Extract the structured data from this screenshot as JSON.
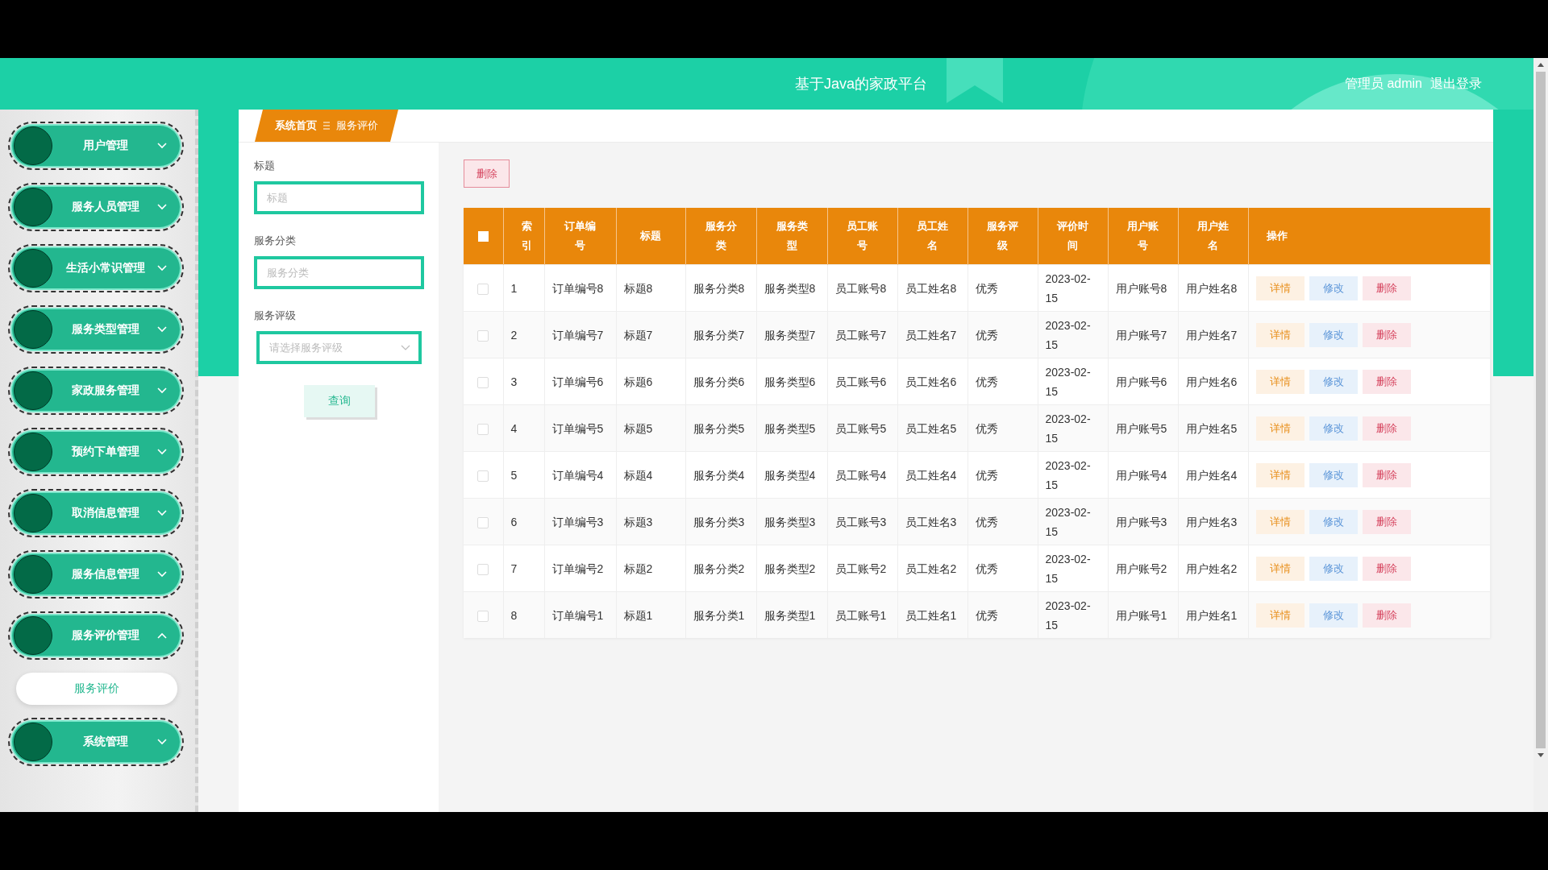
{
  "header": {
    "title": "基于Java的家政平台",
    "user": "管理员 admin",
    "logout": "退出登录"
  },
  "sidebar": {
    "items": [
      {
        "label": "用户管理",
        "expanded": false
      },
      {
        "label": "服务人员管理",
        "expanded": false
      },
      {
        "label": "生活小常识管理",
        "expanded": false
      },
      {
        "label": "服务类型管理",
        "expanded": false
      },
      {
        "label": "家政服务管理",
        "expanded": false
      },
      {
        "label": "预约下单管理",
        "expanded": false
      },
      {
        "label": "取消信息管理",
        "expanded": false
      },
      {
        "label": "服务信息管理",
        "expanded": false
      },
      {
        "label": "服务评价管理",
        "expanded": true,
        "children": [
          {
            "label": "服务评价",
            "selected": true
          }
        ]
      },
      {
        "label": "系统管理",
        "expanded": false
      }
    ]
  },
  "breadcrumb": {
    "home": "系统首页",
    "current": "服务评价"
  },
  "search": {
    "fields": [
      {
        "kind": "input",
        "label": "标题",
        "placeholder": "标题"
      },
      {
        "kind": "input",
        "label": "服务分类",
        "placeholder": "服务分类"
      },
      {
        "kind": "select",
        "label": "服务评级",
        "placeholder": "请选择服务评级"
      }
    ],
    "button": "查询"
  },
  "toolbar": {
    "delete": "删除"
  },
  "table": {
    "columns": [
      "索引",
      "订单编号",
      "标题",
      "服务分类",
      "服务类型",
      "员工账号",
      "员工姓名",
      "服务评级",
      "评价时间",
      "用户账号",
      "用户姓名",
      "操作"
    ],
    "select_all_checked": false,
    "rows": [
      {
        "checked": false,
        "cells": [
          "1",
          "订单编号8",
          "标题8",
          "服务分类8",
          "服务类型8",
          "员工账号8",
          "员工姓名8",
          "优秀",
          "2023-02-15",
          "用户账号8",
          "用户姓名8"
        ],
        "actions": [
          {
            "kind": "detail",
            "label": "详情"
          },
          {
            "kind": "edit",
            "label": "修改"
          },
          {
            "kind": "delete",
            "label": "删除"
          }
        ]
      },
      {
        "checked": false,
        "cells": [
          "2",
          "订单编号7",
          "标题7",
          "服务分类7",
          "服务类型7",
          "员工账号7",
          "员工姓名7",
          "优秀",
          "2023-02-15",
          "用户账号7",
          "用户姓名7"
        ],
        "actions": [
          {
            "kind": "detail",
            "label": "详情"
          },
          {
            "kind": "edit",
            "label": "修改"
          },
          {
            "kind": "delete",
            "label": "删除"
          }
        ]
      },
      {
        "checked": false,
        "cells": [
          "3",
          "订单编号6",
          "标题6",
          "服务分类6",
          "服务类型6",
          "员工账号6",
          "员工姓名6",
          "优秀",
          "2023-02-15",
          "用户账号6",
          "用户姓名6"
        ],
        "actions": [
          {
            "kind": "detail",
            "label": "详情"
          },
          {
            "kind": "edit",
            "label": "修改"
          },
          {
            "kind": "delete",
            "label": "删除"
          }
        ]
      },
      {
        "checked": false,
        "cells": [
          "4",
          "订单编号5",
          "标题5",
          "服务分类5",
          "服务类型5",
          "员工账号5",
          "员工姓名5",
          "优秀",
          "2023-02-15",
          "用户账号5",
          "用户姓名5"
        ],
        "actions": [
          {
            "kind": "detail",
            "label": "详情"
          },
          {
            "kind": "edit",
            "label": "修改"
          },
          {
            "kind": "delete",
            "label": "删除"
          }
        ]
      },
      {
        "checked": false,
        "cells": [
          "5",
          "订单编号4",
          "标题4",
          "服务分类4",
          "服务类型4",
          "员工账号4",
          "员工姓名4",
          "优秀",
          "2023-02-15",
          "用户账号4",
          "用户姓名4"
        ],
        "actions": [
          {
            "kind": "detail",
            "label": "详情"
          },
          {
            "kind": "edit",
            "label": "修改"
          },
          {
            "kind": "delete",
            "label": "删除"
          }
        ]
      },
      {
        "checked": false,
        "cells": [
          "6",
          "订单编号3",
          "标题3",
          "服务分类3",
          "服务类型3",
          "员工账号3",
          "员工姓名3",
          "优秀",
          "2023-02-15",
          "用户账号3",
          "用户姓名3"
        ],
        "actions": [
          {
            "kind": "detail",
            "label": "详情"
          },
          {
            "kind": "edit",
            "label": "修改"
          },
          {
            "kind": "delete",
            "label": "删除"
          }
        ]
      },
      {
        "checked": false,
        "cells": [
          "7",
          "订单编号2",
          "标题2",
          "服务分类2",
          "服务类型2",
          "员工账号2",
          "员工姓名2",
          "优秀",
          "2023-02-15",
          "用户账号2",
          "用户姓名2"
        ],
        "actions": [
          {
            "kind": "detail",
            "label": "详情"
          },
          {
            "kind": "edit",
            "label": "修改"
          },
          {
            "kind": "delete",
            "label": "删除"
          }
        ]
      },
      {
        "checked": false,
        "cells": [
          "8",
          "订单编号1",
          "标题1",
          "服务分类1",
          "服务类型1",
          "员工账号1",
          "员工姓名1",
          "优秀",
          "2023-02-15",
          "用户账号1",
          "用户姓名1"
        ],
        "actions": [
          {
            "kind": "detail",
            "label": "详情"
          },
          {
            "kind": "edit",
            "label": "修改"
          },
          {
            "kind": "delete",
            "label": "删除"
          }
        ]
      }
    ]
  }
}
